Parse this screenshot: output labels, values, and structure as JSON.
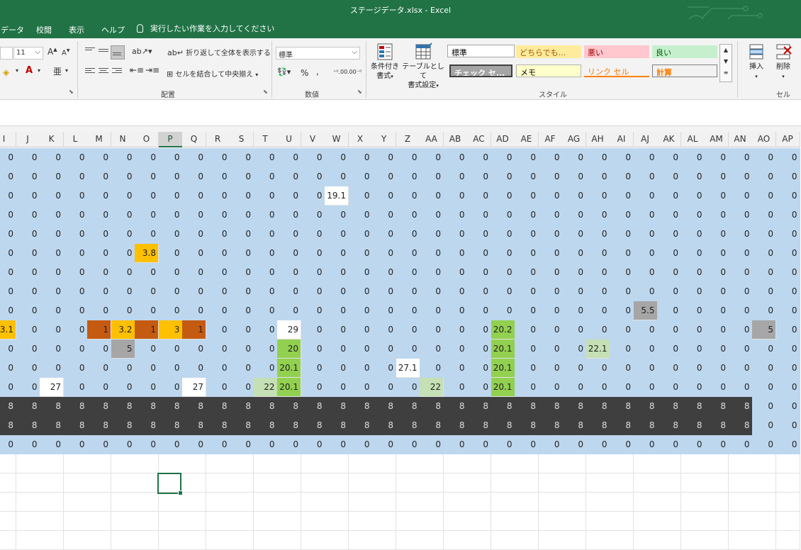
{
  "window": {
    "title": "ステージデータ.xlsx  -  Excel"
  },
  "tabs": [
    {
      "label": "データ"
    },
    {
      "label": "校閲"
    },
    {
      "label": "表示"
    },
    {
      "label": "ヘルプ"
    }
  ],
  "tell_me": {
    "label": "実行したい作業を入力してください"
  },
  "ribbon": {
    "font_size": "11",
    "font_grow": "A",
    "font_shrink": "A",
    "wrap_text": "折り返して全体を表示する",
    "merge_center": "セルを結合して中央揃え",
    "alignment_group": "配置",
    "number_format": "標準",
    "percent": "%",
    "comma": ",",
    "number_group": "数値",
    "conditional_format": [
      "条件付き",
      "書式"
    ],
    "format_as_table": [
      "テーブルとして",
      "書式設定"
    ],
    "styles_group": "スタイル",
    "styles": {
      "normal": "標準",
      "neutral": "どちらでも...",
      "bad": "悪い",
      "good": "良い",
      "check_cell": "チェック セ...",
      "note": "メモ",
      "link_cell": "リンク セル",
      "calculation": "計算"
    },
    "insert": "挿入",
    "delete": "削除",
    "cells_group": "セル"
  },
  "colors": {
    "excel_green": "#217346",
    "light_blue": "#bdd7ee",
    "dark_gray": "#3f3f3f",
    "orange": "#ffc000",
    "dark_orange": "#c55a11",
    "gray": "#a6a6a6",
    "green": "#92d050",
    "light_green": "#c5e0b4"
  },
  "grid": {
    "columns": [
      "I",
      "J",
      "K",
      "L",
      "M",
      "N",
      "O",
      "P",
      "Q",
      "R",
      "S",
      "T",
      "U",
      "V",
      "W",
      "X",
      "Y",
      "Z",
      "AA",
      "AB",
      "AC",
      "AD",
      "AE",
      "AF",
      "AG",
      "AH",
      "AI",
      "AJ",
      "AK",
      "AL",
      "AM",
      "AN",
      "AO",
      "AP"
    ],
    "selected_column": "P",
    "rows": [
      [
        "0",
        "0",
        "0",
        "0",
        "0",
        "0",
        "0",
        "0",
        "0",
        "0",
        "0",
        "0",
        "0",
        "0",
        "0",
        "0",
        "0",
        "0",
        "0",
        "0",
        "0",
        "0",
        "0",
        "0",
        "0",
        "0",
        "0",
        "0",
        "0",
        "0",
        "0",
        "0",
        "0",
        "0"
      ],
      [
        "0",
        "0",
        "0",
        "0",
        "0",
        "0",
        "0",
        "0",
        "0",
        "0",
        "0",
        "0",
        "0",
        "0",
        "0",
        "0",
        "0",
        "0",
        "0",
        "0",
        "0",
        "0",
        "0",
        "0",
        "0",
        "0",
        "0",
        "0",
        "0",
        "0",
        "0",
        "0",
        "0",
        "0"
      ],
      [
        "0",
        "0",
        "0",
        "0",
        "0",
        "0",
        "0",
        "0",
        "0",
        "0",
        "0",
        "0",
        "0",
        "0",
        "19.1",
        "0",
        "0",
        "0",
        "0",
        "0",
        "0",
        "0",
        "0",
        "0",
        "0",
        "0",
        "0",
        "0",
        "0",
        "0",
        "0",
        "0",
        "0",
        "0"
      ],
      [
        "0",
        "0",
        "0",
        "0",
        "0",
        "0",
        "0",
        "0",
        "0",
        "0",
        "0",
        "0",
        "0",
        "0",
        "0",
        "0",
        "0",
        "0",
        "0",
        "0",
        "0",
        "0",
        "0",
        "0",
        "0",
        "0",
        "0",
        "0",
        "0",
        "0",
        "0",
        "0",
        "0",
        "0"
      ],
      [
        "0",
        "0",
        "0",
        "0",
        "0",
        "0",
        "0",
        "0",
        "0",
        "0",
        "0",
        "0",
        "0",
        "0",
        "0",
        "0",
        "0",
        "0",
        "0",
        "0",
        "0",
        "0",
        "0",
        "0",
        "0",
        "0",
        "0",
        "0",
        "0",
        "0",
        "0",
        "0",
        "0",
        "0"
      ],
      [
        "0",
        "0",
        "0",
        "0",
        "0",
        "0",
        "3.8",
        "0",
        "0",
        "0",
        "0",
        "0",
        "0",
        "0",
        "0",
        "0",
        "0",
        "0",
        "0",
        "0",
        "0",
        "0",
        "0",
        "0",
        "0",
        "0",
        "0",
        "0",
        "0",
        "0",
        "0",
        "0",
        "0",
        "0"
      ],
      [
        "0",
        "0",
        "0",
        "0",
        "0",
        "0",
        "0",
        "0",
        "0",
        "0",
        "0",
        "0",
        "0",
        "0",
        "0",
        "0",
        "0",
        "0",
        "0",
        "0",
        "0",
        "0",
        "0",
        "0",
        "0",
        "0",
        "0",
        "0",
        "0",
        "0",
        "0",
        "0",
        "0",
        "0"
      ],
      [
        "0",
        "0",
        "0",
        "0",
        "0",
        "0",
        "0",
        "0",
        "0",
        "0",
        "0",
        "0",
        "0",
        "0",
        "0",
        "0",
        "0",
        "0",
        "0",
        "0",
        "0",
        "0",
        "0",
        "0",
        "0",
        "0",
        "0",
        "0",
        "0",
        "0",
        "0",
        "0",
        "0",
        "0"
      ],
      [
        "0",
        "0",
        "0",
        "0",
        "0",
        "0",
        "0",
        "0",
        "0",
        "0",
        "0",
        "0",
        "0",
        "0",
        "0",
        "0",
        "0",
        "0",
        "0",
        "0",
        "0",
        "0",
        "0",
        "0",
        "0",
        "0",
        "0",
        "5.5",
        "0",
        "0",
        "0",
        "0",
        "0",
        "0"
      ],
      [
        "3.1",
        "0",
        "0",
        "0",
        "1",
        "3.2",
        "1",
        "3",
        "1",
        "0",
        "0",
        "0",
        "29",
        "0",
        "0",
        "0",
        "0",
        "0",
        "0",
        "0",
        "0",
        "20.2",
        "0",
        "0",
        "0",
        "0",
        "0",
        "0",
        "0",
        "0",
        "0",
        "0",
        "5",
        "0"
      ],
      [
        "0",
        "0",
        "0",
        "0",
        "0",
        "5",
        "0",
        "0",
        "0",
        "0",
        "0",
        "0",
        "20",
        "0",
        "0",
        "0",
        "0",
        "0",
        "0",
        "0",
        "0",
        "20.1",
        "0",
        "0",
        "0",
        "22.1",
        "0",
        "0",
        "0",
        "0",
        "0",
        "0",
        "0",
        "0"
      ],
      [
        "0",
        "0",
        "0",
        "0",
        "0",
        "0",
        "0",
        "0",
        "0",
        "0",
        "0",
        "0",
        "20.1",
        "0",
        "0",
        "0",
        "0",
        "27.1",
        "0",
        "0",
        "0",
        "20.1",
        "0",
        "0",
        "0",
        "0",
        "0",
        "0",
        "0",
        "0",
        "0",
        "0",
        "0",
        "0"
      ],
      [
        "0",
        "0",
        "27",
        "0",
        "0",
        "0",
        "0",
        "0",
        "27",
        "0",
        "0",
        "22",
        "20.1",
        "0",
        "0",
        "0",
        "0",
        "0",
        "22",
        "0",
        "0",
        "20.1",
        "0",
        "0",
        "0",
        "0",
        "0",
        "0",
        "0",
        "0",
        "0",
        "0",
        "0",
        "0"
      ],
      [
        "8",
        "8",
        "8",
        "8",
        "8",
        "8",
        "8",
        "8",
        "8",
        "8",
        "8",
        "8",
        "8",
        "8",
        "8",
        "8",
        "8",
        "8",
        "8",
        "8",
        "8",
        "8",
        "8",
        "8",
        "8",
        "8",
        "8",
        "8",
        "8",
        "8",
        "8",
        "8",
        "0",
        "0"
      ],
      [
        "8",
        "8",
        "8",
        "8",
        "8",
        "8",
        "8",
        "8",
        "8",
        "8",
        "8",
        "8",
        "8",
        "8",
        "8",
        "8",
        "8",
        "8",
        "8",
        "8",
        "8",
        "8",
        "8",
        "8",
        "8",
        "8",
        "8",
        "8",
        "8",
        "8",
        "8",
        "8",
        "0",
        "0"
      ],
      [
        "0",
        "0",
        "0",
        "0",
        "0",
        "0",
        "0",
        "0",
        "0",
        "0",
        "0",
        "0",
        "0",
        "0",
        "0",
        "0",
        "0",
        "0",
        "0",
        "0",
        "0",
        "0",
        "0",
        "0",
        "0",
        "0",
        "0",
        "0",
        "0",
        "0",
        "0",
        "0",
        "0",
        "0"
      ]
    ],
    "cell_fills": {
      "2,14": "white",
      "5,6": "orange",
      "8,27": "gray",
      "9,0": "orange",
      "9,4": "darkorange",
      "9,5": "orange",
      "9,6": "darkorange",
      "9,7": "orange",
      "9,8": "darkorange",
      "9,12": "white",
      "9,21": "green",
      "9,32": "gray",
      "10,5": "gray",
      "10,12": "green",
      "10,21": "green",
      "10,25": "lightgreen",
      "11,12": "green",
      "11,17": "white",
      "11,21": "green",
      "12,2": "white",
      "12,8": "white",
      "12,11": "lightgreen",
      "12,12": "green",
      "12,18": "lightgreen",
      "12,21": "green"
    }
  }
}
